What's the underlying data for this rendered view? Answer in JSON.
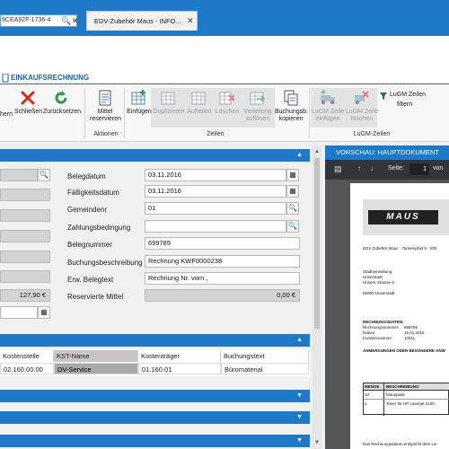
{
  "browser": {
    "address": "9CEA92F-1736-4",
    "tab_title": "EDV-Zubehör Maus - INFO..."
  },
  "ribbon": {
    "tab": "EINKAUFSRECHNUNG",
    "buttons": {
      "speichern": "hern",
      "schliessen": "Schließen",
      "zuruecksetzen": "Zurücksetzen",
      "mittel_line1": "Mittel",
      "mittel_line2": "reservieren",
      "einfuegen": "Einfügen",
      "duplizieren": "Duplizieren",
      "aufteilen": "Aufteilen",
      "loeschen": "Löschen",
      "verteilung_line1": "Verteilung",
      "verteilung_line2": "auflösen",
      "buchungsbeleg_line1": "Buchungsb.",
      "buchungsbeleg_line2": "kopieren",
      "lugm_einfuegen_line1": "LuGM Zeile",
      "lugm_einfuegen_line2": "einfügen",
      "lugm_loeschen_line1": "LuGM Zeile",
      "lugm_loeschen_line2": "löschen",
      "lugm_filtern_line1": "LuGM Zeilen",
      "lugm_filtern_line2": "filtern"
    },
    "groups": {
      "aktionen": "Aktionen",
      "zeilen": "Zeilen",
      "lugm": "LuGM-Zeilen"
    }
  },
  "form": {
    "belegdatum": {
      "label": "Belegdatum",
      "value": "03.11.2016"
    },
    "faelligkeitsdatum": {
      "label": "Fälligkeitsdatum",
      "value": "03.11.2016"
    },
    "gemeindenr": {
      "label": "Gemeindenr",
      "value": "01"
    },
    "zahlungsbedingung": {
      "label": "Zahlungsbedingung",
      "value": ""
    },
    "belegnummer": {
      "label": "Belegnummer",
      "value": "699785"
    },
    "buchungsbeschreibung": {
      "label": "Buchungsbeschreibung",
      "value": "Rechnung KWF0000238"
    },
    "erw_belegtext": {
      "label": "Erw. Belegtext",
      "value": "Rechnung Nr.  vom ,"
    },
    "reservierte_mittel": {
      "label": "Reservierte Mittel",
      "value": "0,00 €"
    },
    "left_amount": "127,90 €"
  },
  "grid": {
    "headers": [
      "Kostenstelle",
      "KST-Name",
      "Kostenträger",
      "Buchungstext"
    ],
    "row": [
      "02.160.00.00",
      "DV-Service",
      "01.160.01",
      "Büromaterial"
    ]
  },
  "preview": {
    "title": "VORSCHAU: HAUPTDOKUMENT",
    "page_label": "Seite:",
    "page_num": "1",
    "page_of": "von",
    "doc": {
      "logo": "MAUS",
      "sender": "EDV Zubehör Maus - Tannenpfad 8 - 555",
      "addr1": "Stadtverwaltung",
      "addr2": "Unserstadt",
      "addr3": "Unsere Strasse 3",
      "addr4": "55000 Unserstadt",
      "hdr": "RECHNUNGSDATEN:",
      "r1l": "Rechnungsnummer:",
      "r1v": "699785",
      "r2l": "Datum:",
      "r2v": "15.01.2016",
      "r3l": "Kundennummer:",
      "r3v": "10011",
      "anm": "ANMERKUNGEN ODER BESONDERE ANW",
      "col1": "MENGE",
      "col2": "BESCHREIBUNG",
      "i1q": "10",
      "i1d": "Mauspads",
      "i2q": "1",
      "i2d": "Toner für HP Laserjet 2100",
      "footer": "Das Rechnungsdatum entspricht dem Lie"
    }
  },
  "colors": {
    "accent": "#1e79c8",
    "close_red": "#d9261c",
    "refresh_green": "#2e9a4e"
  }
}
